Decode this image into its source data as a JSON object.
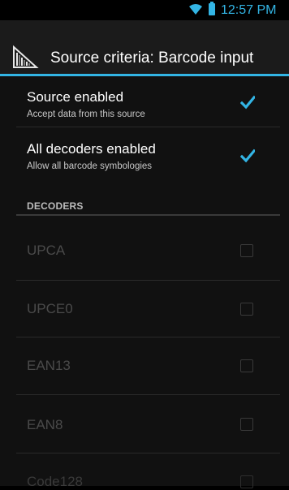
{
  "status_bar": {
    "time": "12:57 PM",
    "icons": [
      "wifi-icon",
      "battery-icon"
    ]
  },
  "action_bar": {
    "title": "Source criteria: Barcode input",
    "icon": "barcode-app-icon"
  },
  "preferences": [
    {
      "title": "Source enabled",
      "summary": "Accept data from this source",
      "checked": true
    },
    {
      "title": "All decoders enabled",
      "summary": "Allow all barcode symbologies",
      "checked": true
    }
  ],
  "decoders_section": {
    "header": "DECODERS",
    "items": [
      {
        "label": "UPCA",
        "checked": false,
        "enabled": false
      },
      {
        "label": "UPCE0",
        "checked": false,
        "enabled": false
      },
      {
        "label": "EAN13",
        "checked": false,
        "enabled": false
      },
      {
        "label": "EAN8",
        "checked": false,
        "enabled": false
      },
      {
        "label": "Code128",
        "checked": false,
        "enabled": false
      }
    ]
  },
  "colors": {
    "accent": "#33b5e5",
    "background": "#111111",
    "action_bar": "#1b1b1b",
    "disabled_text": "#4a4a4a"
  }
}
